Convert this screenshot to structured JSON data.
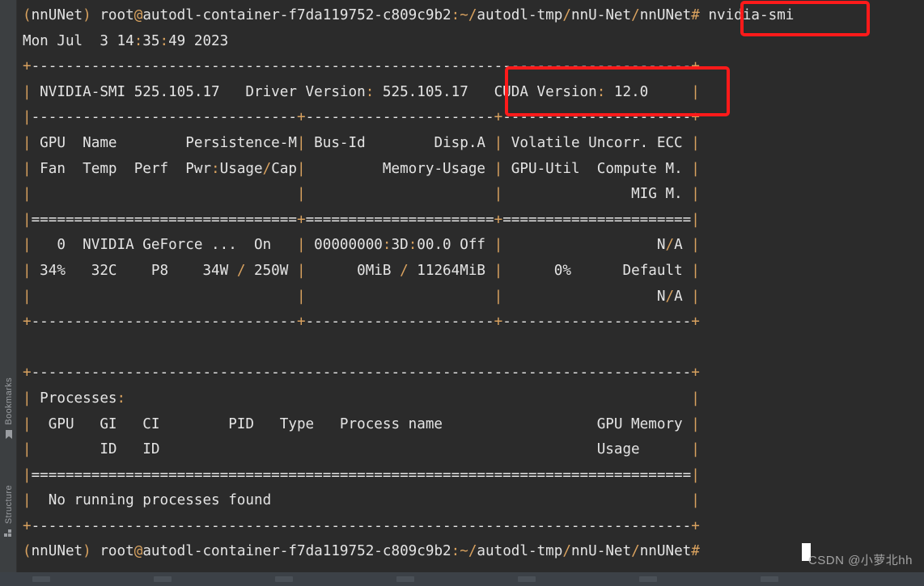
{
  "app": {
    "background_color": "#2b2b2b",
    "sidebar_color": "#3c3f41",
    "accent_red": "#ff1a1a",
    "text_color": "#e4e4e4",
    "punct_color": "#d9a25f"
  },
  "sidebar": {
    "tools": [
      {
        "id": "bookmarks",
        "label": "Bookmarks",
        "icon": "bookmark-icon"
      },
      {
        "id": "structure",
        "label": "Structure",
        "icon": "structure-icon"
      }
    ]
  },
  "terminal": {
    "lines": [
      "(nnUNet) root@autodl-container-f7da119752-c809c9b2:~/autodl-tmp/nnU-Net/nnUNet# nvidia-smi",
      "Mon Jul  3 14:35:49 2023",
      "+-----------------------------------------------------------------------------+",
      "| NVIDIA-SMI 525.105.17   Driver Version: 525.105.17   CUDA Version: 12.0     |",
      "|-------------------------------+----------------------+----------------------+",
      "| GPU  Name        Persistence-M| Bus-Id        Disp.A | Volatile Uncorr. ECC |",
      "| Fan  Temp  Perf  Pwr:Usage/Cap|         Memory-Usage | GPU-Util  Compute M. |",
      "|                               |                      |               MIG M. |",
      "|===============================+======================+======================|",
      "|   0  NVIDIA GeForce ...  On   | 00000000:3D:00.0 Off |                  N/A |",
      "| 34%   32C    P8    34W / 250W |      0MiB / 11264MiB |      0%      Default |",
      "|                               |                      |                  N/A |",
      "+-------------------------------+----------------------+----------------------+",
      "",
      "+-----------------------------------------------------------------------------+",
      "| Processes:                                                                  |",
      "|  GPU   GI   CI        PID   Type   Process name                  GPU Memory |",
      "|        ID   ID                                                   Usage      |",
      "|=============================================================================|",
      "|  No running processes found                                                 |",
      "+-----------------------------------------------------------------------------+",
      "(nnUNet) root@autodl-container-f7da119752-c809c9b2:~/autodl-tmp/nnU-Net/nnUNet#"
    ],
    "command_entered": "nvidia-smi",
    "timestamp": "Mon Jul  3 14:35:49 2023",
    "prompt": "(nnUNet) root@autodl-container-f7da119752-c809c9b2:~/autodl-tmp/nnU-Net/nnUNet#"
  },
  "nvidia_smi": {
    "smi_version": "NVIDIA-SMI 525.105.17",
    "driver_version": "Driver Version: 525.105.17",
    "cuda_version": "CUDA Version: 12.0",
    "table_headers_row1": "| GPU  Name        Persistence-M| Bus-Id        Disp.A | Volatile Uncorr. ECC |",
    "table_headers_row2": "| Fan  Temp  Perf  Pwr:Usage/Cap|         Memory-Usage | GPU-Util  Compute M. |",
    "table_headers_row3": "|                               |                      |               MIG M. |",
    "gpu_row1": "|   0  NVIDIA GeForce ...  On   | 00000000:3D:00.0 Off |                  N/A |",
    "gpu_row2": "| 34%   32C    P8    34W / 250W |      0MiB / 11264MiB |      0%      Default |",
    "gpu_row3": "|                               |                      |                  N/A |",
    "gpu_index": "0",
    "gpu_name": "NVIDIA GeForce ...",
    "persistence_m": "On",
    "bus_id": "00000000:3D:00.0",
    "disp_a": "Off",
    "uncorr_ecc": "N/A",
    "fan": "34%",
    "temp": "32C",
    "perf": "P8",
    "pwr_usage_cap": "34W / 250W",
    "memory_usage": "0MiB / 11264MiB",
    "gpu_util": "0%",
    "compute_m": "Default",
    "mig_m": "N/A",
    "processes_title": "Processes:",
    "processes_headers_row1": "|  GPU   GI   CI        PID   Type   Process name                  GPU Memory |",
    "processes_headers_row2": "|        ID   ID                                                   Usage      |",
    "processes_empty": "|  No running processes found                                                 |"
  },
  "annotations": [
    {
      "id": "nvidia-smi-command",
      "target": "nvidia-smi"
    },
    {
      "id": "cuda-version",
      "target": "CUDA Version: 12.0"
    }
  ],
  "watermark": {
    "text": "CSDN @小萝北hh"
  }
}
